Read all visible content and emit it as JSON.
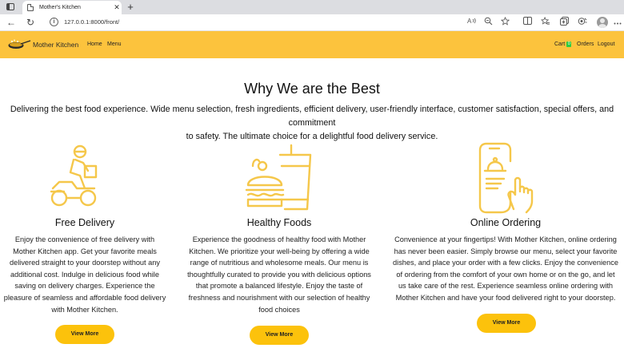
{
  "browser": {
    "tab_title": "Mother's Kitchen",
    "tab_close": "✕",
    "new_tab": "+",
    "url": "127.0.0.1:8000/front/",
    "back": "←",
    "reload": "↻"
  },
  "icons": {
    "window": "window-icon",
    "favicon": "page-icon",
    "read_aloud": "read-aloud-icon",
    "zoom": "zoom-icon",
    "favorite": "star-icon",
    "split": "split-screen-icon",
    "favorites": "favorites-icon",
    "collections": "collections-icon",
    "extensions": "extensions-icon",
    "more": "more-icon"
  },
  "nav": {
    "brand": "Mother Kitchen",
    "home": "Home",
    "menu": "Menu",
    "cart": "Cart",
    "cart_count": "0",
    "orders": "Orders",
    "logout": "Logout"
  },
  "colors": {
    "accent": "#fcc33d",
    "button": "#fcc20c",
    "icon": "#f5c74a"
  },
  "section": {
    "title": "Why We are the Best",
    "intro_line1": "Delivering the best food experience. Wide menu selection, fresh ingredients, efficient delivery, user-friendly interface, customer satisfaction, special offers, and commitment",
    "intro_line2": "to safety. The ultimate choice for a delightful food delivery service."
  },
  "features": [
    {
      "icon": "delivery-scooter-icon",
      "title": "Free Delivery",
      "lines": [
        "Enjoy the convenience of free delivery with",
        "Mother Kitchen app. Get your favorite meals",
        "delivered straight to your doorstep without any",
        "additional cost. Indulge in delicious food while",
        "saving on delivery charges. Experience the",
        "pleasure of seamless and affordable food delivery",
        "with Mother Kitchen."
      ],
      "button": "View More"
    },
    {
      "icon": "burger-drink-icon",
      "title": "Healthy Foods",
      "lines": [
        "Experience the goodness of healthy food with Mother",
        "Kitchen. We prioritize your well-being by offering a wide",
        "range of nutritious and wholesome meals. Our menu is",
        "thoughtfully curated to provide you with delicious options",
        "that promote a balanced lifestyle. Enjoy the taste of",
        "freshness and nourishment with our selection of healthy",
        "food choices"
      ],
      "button": "View More"
    },
    {
      "icon": "phone-order-icon",
      "title": "Online Ordering",
      "lines": [
        "Convenience at your fingertips! With Mother Kitchen, online ordering",
        "has never been easier. Simply browse our menu, select your favorite",
        "dishes, and place your order with a few clicks. Enjoy the convenience",
        "of ordering from the comfort of your own home or on the go, and let",
        "us take care of the rest. Experience seamless online ordering with",
        "Mother Kitchen and have your food delivered right to your doorstep."
      ],
      "button": "View More"
    }
  ]
}
